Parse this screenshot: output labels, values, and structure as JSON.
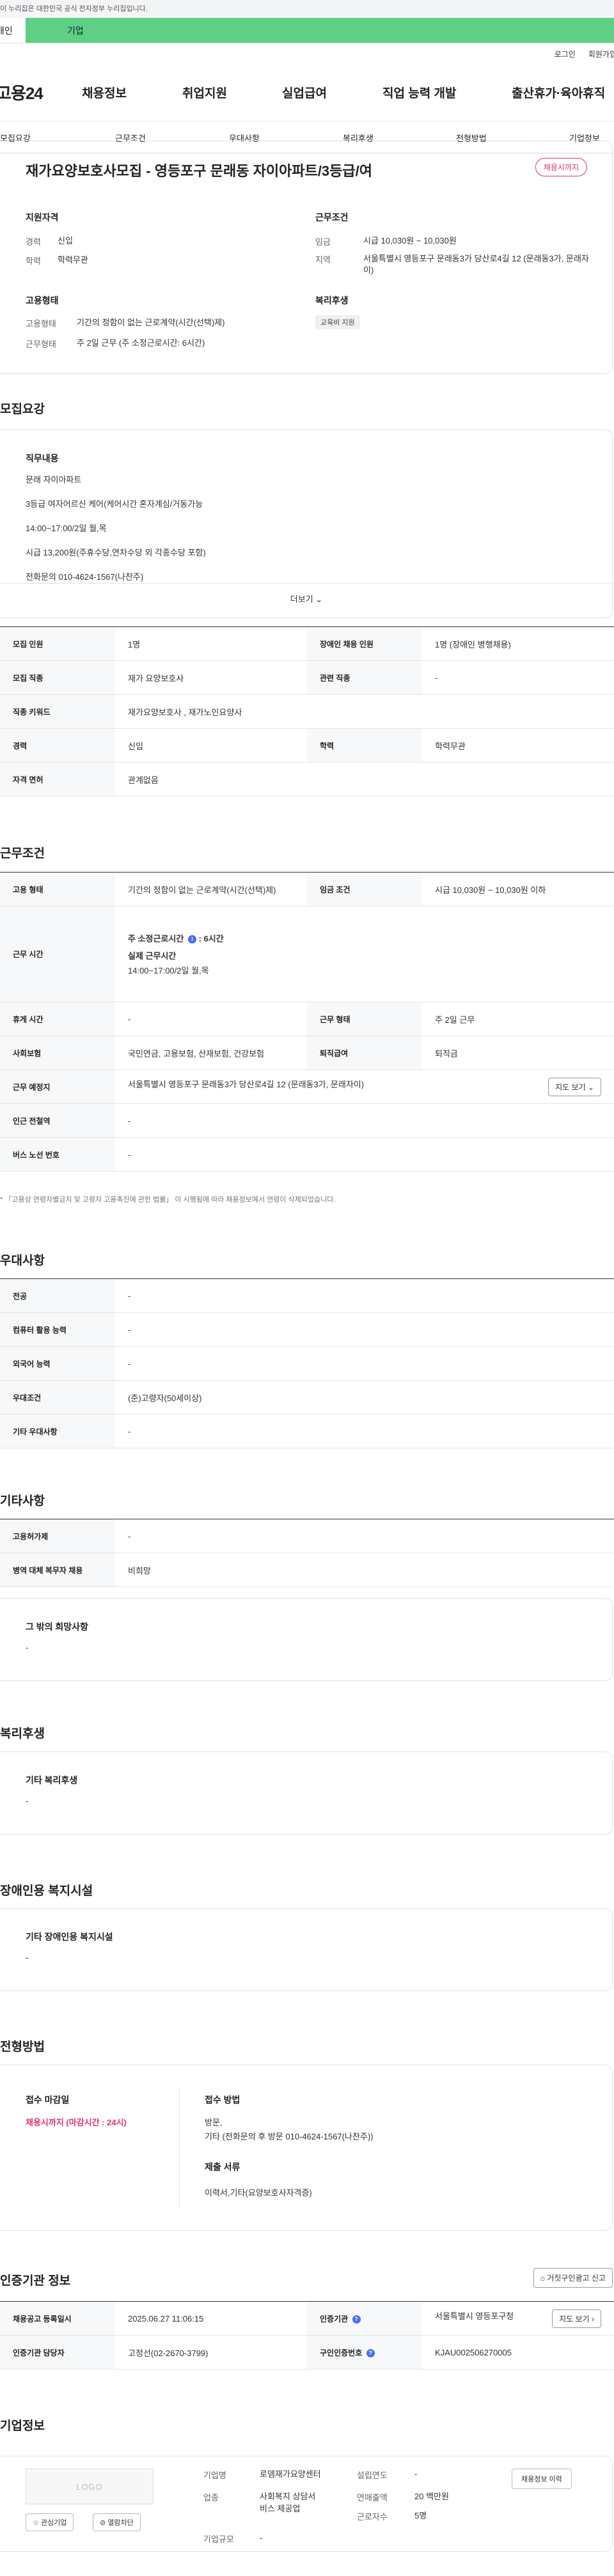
{
  "gov_banner": "이 누리집은 대한민국 공식 전자정부 누리집입니다.",
  "user_tabs": {
    "personal": "개인",
    "corp": "기업"
  },
  "util": {
    "login": "로그인",
    "join": "회원가입"
  },
  "logo": "고용24",
  "gnb": [
    "채용정보",
    "취업지원",
    "실업급여",
    "직업 능력 개발",
    "출산휴가·육아휴직"
  ],
  "anchor_nav": [
    "모집요강",
    "근무조건",
    "우대사항",
    "복리후생",
    "전형방법",
    "기업정보"
  ],
  "job_title": "재가요양보호사모집 - 영등포구 문래동 자이아파트/3등급/여",
  "deadline_badge": "채용시까지",
  "summary": {
    "qual_title": "지원자격",
    "career_k": "경력",
    "career_v": "신입",
    "edu_k": "학력",
    "edu_v": "학력무관",
    "cond_title": "근무조건",
    "wage_k": "임금",
    "wage_v": "시급 10,030원 ~ 10,030원",
    "area_k": "지역",
    "area_v": "서울특별시 영등포구 문래동3가 당산로4길 12 (문래동3가, 문래자이)",
    "emp_title": "고용형태",
    "type_k": "고용형태",
    "type_v": "기간의 정함이 없는 근로계약(시간(선택)제)",
    "worktype_k": "근무형태",
    "worktype_v": "주 2일 근무 (주 소정근로시간: 6시간)",
    "welfare_title": "복리후생",
    "welfare_chip": "교육비 지원"
  },
  "recruit": {
    "section": "모집요강",
    "box_title": "직무내용",
    "lines": [
      "문래 자이아파트",
      "3등급 여자어르신 케어(케어시간 혼자계심/거동가능",
      "14:00~17:00/2일 월,목",
      "시급 13,200원(주휴수당,연차수당 외 각종수당 포함)",
      "전화문의 010-4624-1567(나찬주)"
    ],
    "more": "더보기"
  },
  "recruit_table": [
    [
      "모집 인원",
      "1명",
      "장애인 채용 인원",
      "1명 (장애인 병행채용)"
    ],
    [
      "모집 직종",
      "재가 요양보호사",
      "관련 직종",
      "-"
    ],
    [
      "직종 키워드",
      "재가요양보호사 , 재가노인요양사",
      "",
      ""
    ],
    [
      "경력",
      "신입",
      "학력",
      "학력무관"
    ],
    [
      "자격 면허",
      "관계없음",
      "",
      ""
    ]
  ],
  "work": {
    "section": "근무조건",
    "emp_type_k": "고용 형태",
    "emp_type_v": "기간의 정함이 없는 근로계약(시간(선택)제)",
    "wage_k": "임금 조건",
    "wage_v": "시급 10,030원 ~ 10,030원 이하",
    "hours_k": "근무 시간",
    "hours_week_label": "주 소정근로시간",
    "hours_week_value": ": 6시간",
    "hours_actual_label": "실제 근무시간",
    "hours_actual_value": "14:00~17:00/2일 월,목",
    "rest_k": "휴게 시간",
    "rest_v": "-",
    "form_k": "근무 형태",
    "form_v": "주 2일 근무",
    "ins_k": "사회보험",
    "ins_v": "국민연금, 고용보험, 산재보험, 건강보험",
    "retire_k": "퇴직급여",
    "retire_v": "퇴직금",
    "place_k": "근무 예정지",
    "place_v": "서울특별시 영등포구 문래동3가 당산로4길 12 (문래동3가, 문래자이)",
    "map_btn": "지도 보기",
    "subway_k": "인근 전철역",
    "subway_v": "-",
    "bus_k": "버스 노선 번호",
    "bus_v": "-",
    "note": "* 「고용상 연령차별금지 및 고령자 고용촉진에 관한 법률」 이 시행됨에 따라 채용정보에서 연령이 삭제되었습니다."
  },
  "prefer": {
    "section": "우대사항",
    "rows": [
      [
        "전공",
        "-"
      ],
      [
        "컴퓨터 활용 능력",
        "-"
      ],
      [
        "외국어 능력",
        "-"
      ],
      [
        "우대조건",
        "(준)고령자(50세이상)"
      ],
      [
        "기타 우대사항",
        "-"
      ]
    ]
  },
  "etc": {
    "section": "기타사항",
    "rows": [
      [
        "고용허가제",
        "-"
      ],
      [
        "병역 대체 복무자 채용",
        "비희망"
      ]
    ],
    "box_title": "그 밖의 희망사항",
    "box_value": "-"
  },
  "welfare": {
    "section": "복리후생",
    "box_title": "기타 복리후생",
    "box_value": "-"
  },
  "disabled": {
    "section": "장애인용 복지시설",
    "box_title": "기타 장애인용 복지시설",
    "box_value": "-"
  },
  "apply": {
    "section": "전형방법",
    "deadline_title": "접수 마감일",
    "deadline_value": "채용시까지 (마감시간 : 24시)",
    "method_title": "접수 방법",
    "method_lines": [
      "방문,",
      "기타 (전화문의 후 방문 010-4624-1567(나찬주))"
    ],
    "docs_title": "제출 서류",
    "docs_value": "이력서,기타(요양보호사자격증)"
  },
  "cert": {
    "section": "인증기관 정보",
    "report_btn": "거짓구인광고 신고",
    "rows": [
      [
        "채용공고 등록일시",
        "2025.06.27 11:06:15",
        "인증기관",
        "서울특별시 영등포구청"
      ],
      [
        "인증기관 담당자",
        "고정선(02-2670-3799)",
        "구인인증번호",
        "KJAU002506270005"
      ]
    ],
    "map_btn": "지도 보기"
  },
  "company": {
    "section": "기업정보",
    "logo_text": "LOGO",
    "fav_btn": "관심기업",
    "block_btn": "열람차단",
    "name_k": "기업명",
    "name_v": "로뎀재가요양센터",
    "ind_k": "업종",
    "ind_v1": "사회복지 상담서",
    "ind_v2": "비스 제공업",
    "size_k": "기업규모",
    "size_v": "-",
    "year_k": "설립연도",
    "year_v": "-",
    "sales_k": "연매출액",
    "sales_v": "20 백만원",
    "emp_k": "근로자수",
    "emp_v": "5명",
    "history_btn": "채용정보 이력"
  }
}
